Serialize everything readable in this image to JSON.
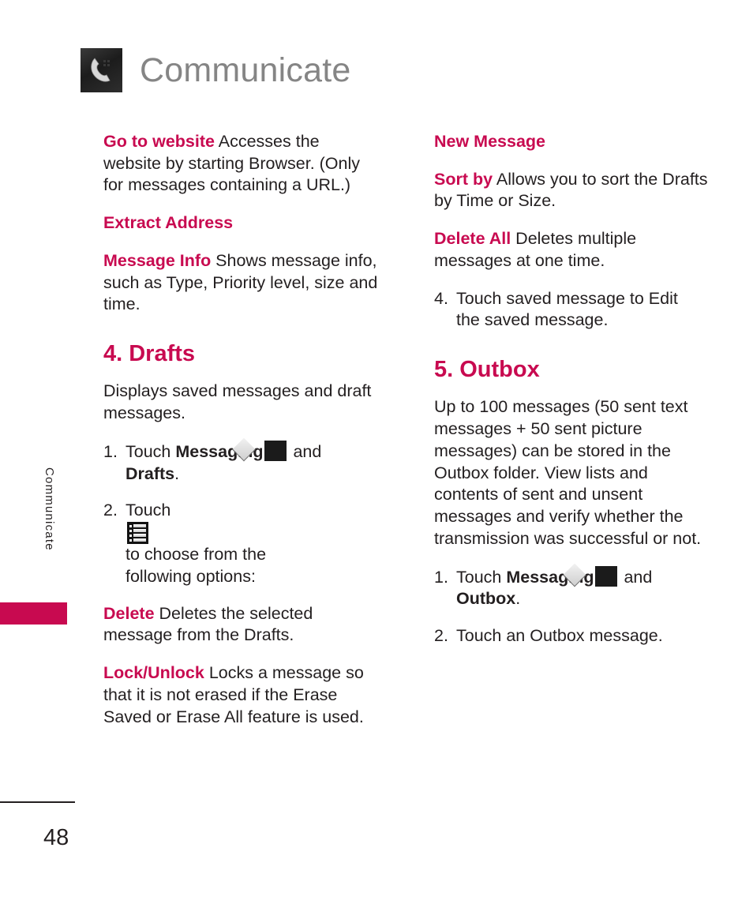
{
  "header": {
    "title": "Communicate",
    "icon": "phone-handset-icon"
  },
  "side_tab": {
    "label": "Communicate",
    "marker_color": "#c80a50"
  },
  "footer": {
    "page_number": "48"
  },
  "colors": {
    "accent": "#c80a50",
    "text": "#231f20",
    "title_gray": "#858585"
  },
  "icons": {
    "messaging": "envelope-icon",
    "options": "list-menu-icon"
  },
  "left_column": {
    "entries": [
      {
        "term": "Go to website",
        "desc": " Accesses the website by starting Browser. (Only for messages containing a URL.)"
      },
      {
        "term": "Extract Address",
        "desc": ""
      },
      {
        "term": "Message Info",
        "desc": " Shows message info, such as Type, Priority level, size and time."
      }
    ],
    "section": {
      "heading": "4. Drafts",
      "intro": "Displays saved messages and draft messages.",
      "steps": [
        {
          "num": "1.",
          "before": "Touch ",
          "bold1": "Messaging",
          "icon": "envelope-icon",
          "middle": " and",
          "bold2": "Drafts",
          "after": "."
        },
        {
          "num": "2.",
          "before": "Touch ",
          "icon": "list-menu-icon",
          "middle": " to choose from the",
          "cont": "following options:"
        }
      ],
      "options": [
        {
          "term": "Delete",
          "desc": " Deletes the selected message from the Drafts."
        },
        {
          "term": "Lock/Unlock",
          "desc": " Locks a message so that it is not erased if the Erase Saved or Erase All feature is used."
        }
      ]
    }
  },
  "right_column": {
    "entries": [
      {
        "term": "New Message",
        "desc": ""
      },
      {
        "term": "Sort by",
        "desc": "  Allows you to sort the Drafts by Time or Size."
      },
      {
        "term": "Delete All",
        "desc": " Deletes multiple messages at one time."
      }
    ],
    "step_after": {
      "num": "4.",
      "line1": "Touch saved message to Edit",
      "line2": "the saved message."
    },
    "section": {
      "heading": "5. Outbox",
      "intro": "Up to 100 messages (50 sent text messages + 50 sent picture messages) can be stored in the Outbox folder. View lists and contents of sent and unsent messages and verify whether the transmission was successful or not.",
      "steps": [
        {
          "num": "1.",
          "before": "Touch ",
          "bold1": "Messaging",
          "icon": "envelope-icon",
          "middle": " and",
          "bold2": "Outbox",
          "after": "."
        },
        {
          "num": "2.",
          "text": "Touch an Outbox message."
        }
      ]
    }
  }
}
